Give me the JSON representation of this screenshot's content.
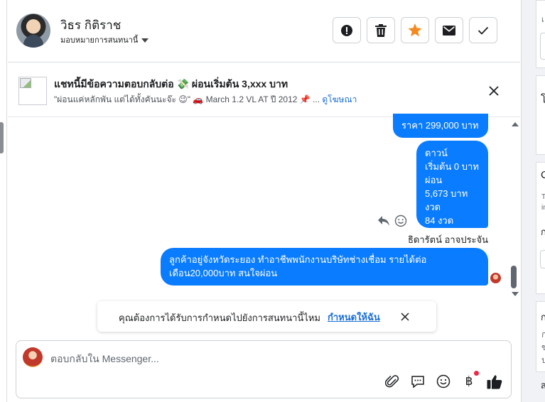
{
  "contact": {
    "name": "วิธร กิติราช",
    "assign_label": "มอบหมายการสนทนานี้"
  },
  "header_actions": [
    {
      "name": "report-icon",
      "label": "!"
    },
    {
      "name": "trash-icon",
      "label": ""
    },
    {
      "name": "star-icon",
      "label": "",
      "color": "#f5891f"
    },
    {
      "name": "mail-icon",
      "label": ""
    },
    {
      "name": "check-icon",
      "label": ""
    }
  ],
  "ad": {
    "title": "แชทนี้มีข้อความตอบกลับต่อ 💸 ผ่อนเริ่มต้น 3,xxx บาท",
    "subtitle": "\"ผ่อนแค่หลักพัน แต่ได้ทั้งคันนะจ๊ะ 😉\" 🚗 March 1.2 VL AT ปี 2012 📌 ...",
    "link": "ดูโฆษณา"
  },
  "messages": {
    "bubble1": "ราคา 299,000 บาท",
    "bubble2_lines": [
      "ดาวน์",
      "เริ่มต้น 0 บาท",
      "ผ่อน",
      "5,673 บาท",
      "งวด",
      "84 งวด"
    ],
    "sender_name": "ธิดารัตน์ อาจประจัน",
    "bubble3": "ลูกค้าอยู่จังหวัดระยอง ทำอาชีพพนักงานบริษัทช่างเชื่อม รายได้ต่อเดือน20,000บาท สนใจผ่อน"
  },
  "reminder": {
    "text": "คุณต้องการได้รับการกำหนดไปยังการสนทนานี้ไหม",
    "link": "กำหนดให้ฉัน"
  },
  "composer": {
    "placeholder": "ตอบกลับใน Messenger...",
    "baht_symbol": "฿"
  },
  "right_panel": {
    "fragments": [
      "เ",
      "โ",
      "C",
      "T",
      "in",
      "ก",
      "ก",
      "ก",
      "ข",
      "ป",
      "ส"
    ]
  },
  "colors": {
    "bubble_blue": "#0a7cff",
    "link_blue": "#1a6ed8",
    "star_orange": "#f5891f",
    "notification_red": "#f02849"
  }
}
